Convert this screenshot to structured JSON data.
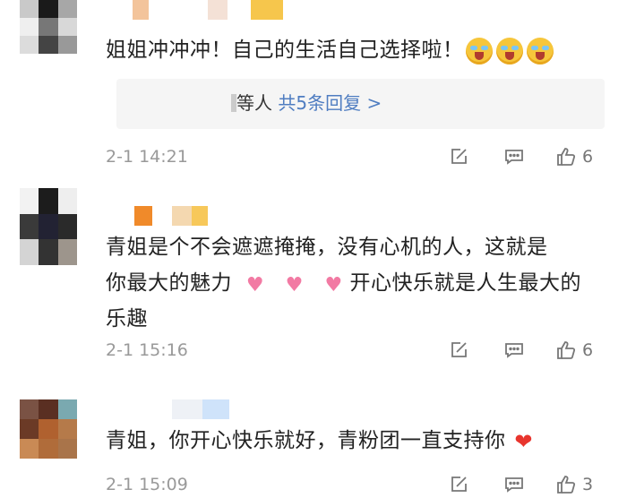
{
  "comments": [
    {
      "text": "姐姐冲冲冲！自己的生活自己选择啦！",
      "reply_suffix": "等人",
      "reply_link": "共5条回复 >",
      "time": "2-1 14:21",
      "likes": "6",
      "emoji": [
        "crying-laughing-icon",
        "crying-laughing-icon",
        "crying-laughing-icon"
      ]
    },
    {
      "text_line1": "青姐是个不会遮遮掩掩，没有心机的人，这就是",
      "text_line2_part1": "你最大的魅力",
      "text_line2_part2": "开心快乐就是人生最大的",
      "text_line3": "乐趣",
      "time": "2-1 15:16",
      "likes": "6",
      "emoji": [
        "heart-hug-icon",
        "heart-hug-icon",
        "heart-hug-icon"
      ]
    },
    {
      "text": "青姐，你开心快乐就好，青粉团一直支持你",
      "time": "2-1 15:09",
      "likes": "3",
      "emoji": [
        "red-heart-icon"
      ]
    }
  ],
  "icons": [
    "share-icon",
    "comment-icon",
    "like-icon"
  ],
  "colors": {
    "link": "#4f7dc1",
    "meta": "#999999",
    "reply_bg": "#f5f5f5"
  }
}
